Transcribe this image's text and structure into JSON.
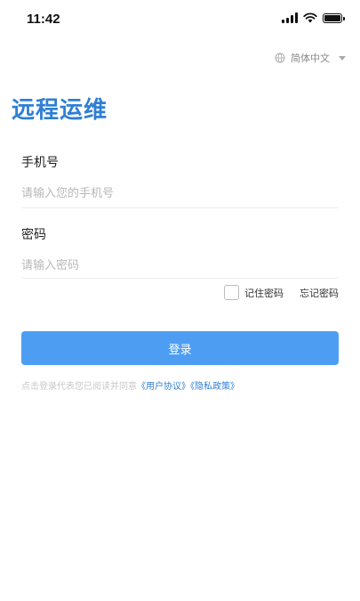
{
  "status_bar": {
    "time": "11:42"
  },
  "language": {
    "selected": "简体中文"
  },
  "app": {
    "title": "远程运维"
  },
  "form": {
    "phone": {
      "label": "手机号",
      "placeholder": "请输入您的手机号",
      "value": ""
    },
    "password": {
      "label": "密码",
      "placeholder": "请输入密码",
      "value": ""
    },
    "remember_label": "记住密码",
    "forgot_label": "忘记密码",
    "login_label": "登录"
  },
  "agreement": {
    "prefix": "点击登录代表您已阅读并同意",
    "user_agreement": "《用户协议》",
    "privacy_policy": "《隐私政策》"
  },
  "colors": {
    "accent": "#4d9ef2",
    "title": "#2f7fd4"
  }
}
